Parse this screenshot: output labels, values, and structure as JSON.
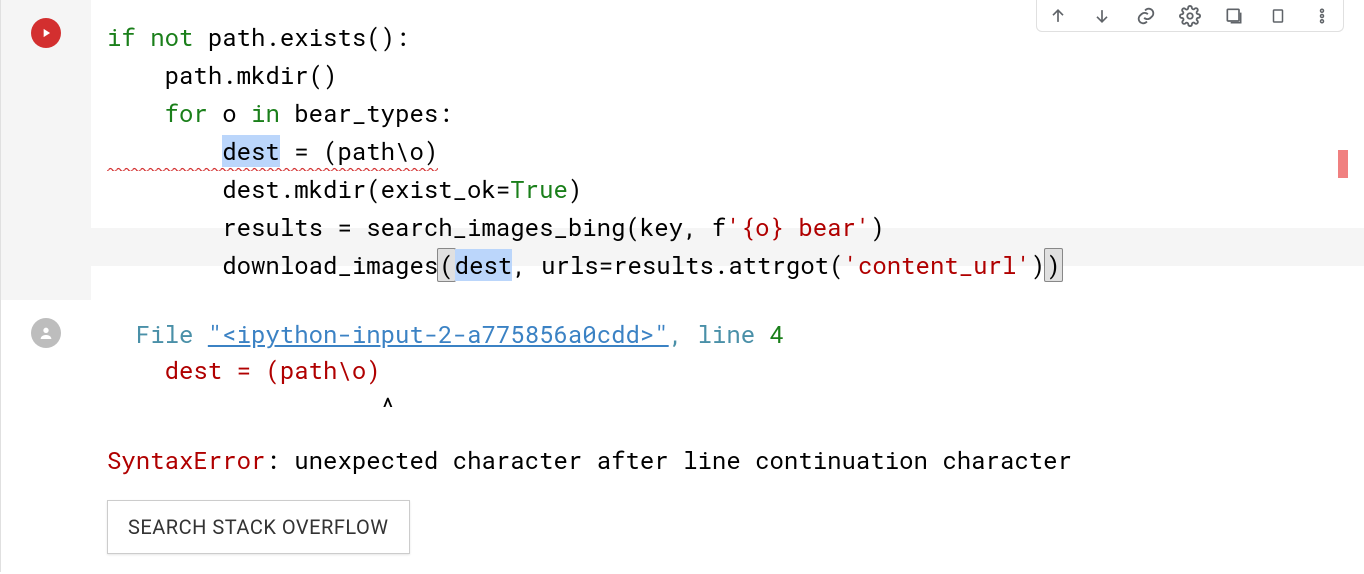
{
  "toolbar": {
    "icons": [
      "move-up",
      "move-down",
      "link",
      "settings",
      "mirror-cell",
      "delete",
      "more"
    ]
  },
  "cell": {
    "code": {
      "line1": {
        "kw_if": "if",
        "kw_not": "not",
        "rest": " path.exists():"
      },
      "line2": "    path.mkdir()",
      "line3": {
        "kw_for": "for",
        "mid": " o ",
        "kw_in": "in",
        "rest": " bear_types:"
      },
      "line4": {
        "indent": "        ",
        "dest": "dest",
        "eq_sp": " = ",
        "paren": "(path\\o)"
      },
      "line5": {
        "indent": "        ",
        "pre": "dest.mkdir(exist_ok=",
        "true": "True",
        "post": ")"
      },
      "line6": {
        "indent": "        ",
        "pre": "results = search_images_bing(key, f",
        "s1": "'{o} bear'",
        "post": ")"
      },
      "line7": {
        "indent": "        ",
        "pre": "download_images",
        "p1": "(",
        "dest": "dest",
        "mid": ", urls=results.attrgot(",
        "s": "'content_url'",
        "p2": ")",
        "p3": ")"
      }
    }
  },
  "output": {
    "file_label": "  File ",
    "file_link": "\"<ipython-input-2-a775856a0cdd>\"",
    "line_sep": ", line ",
    "line_no": "4",
    "err_line": "    dest = (path\\o)",
    "caret": "                   ^",
    "err_name": "SyntaxError",
    "err_msg": ": unexpected character after line continuation character",
    "so_button": "SEARCH STACK OVERFLOW"
  }
}
